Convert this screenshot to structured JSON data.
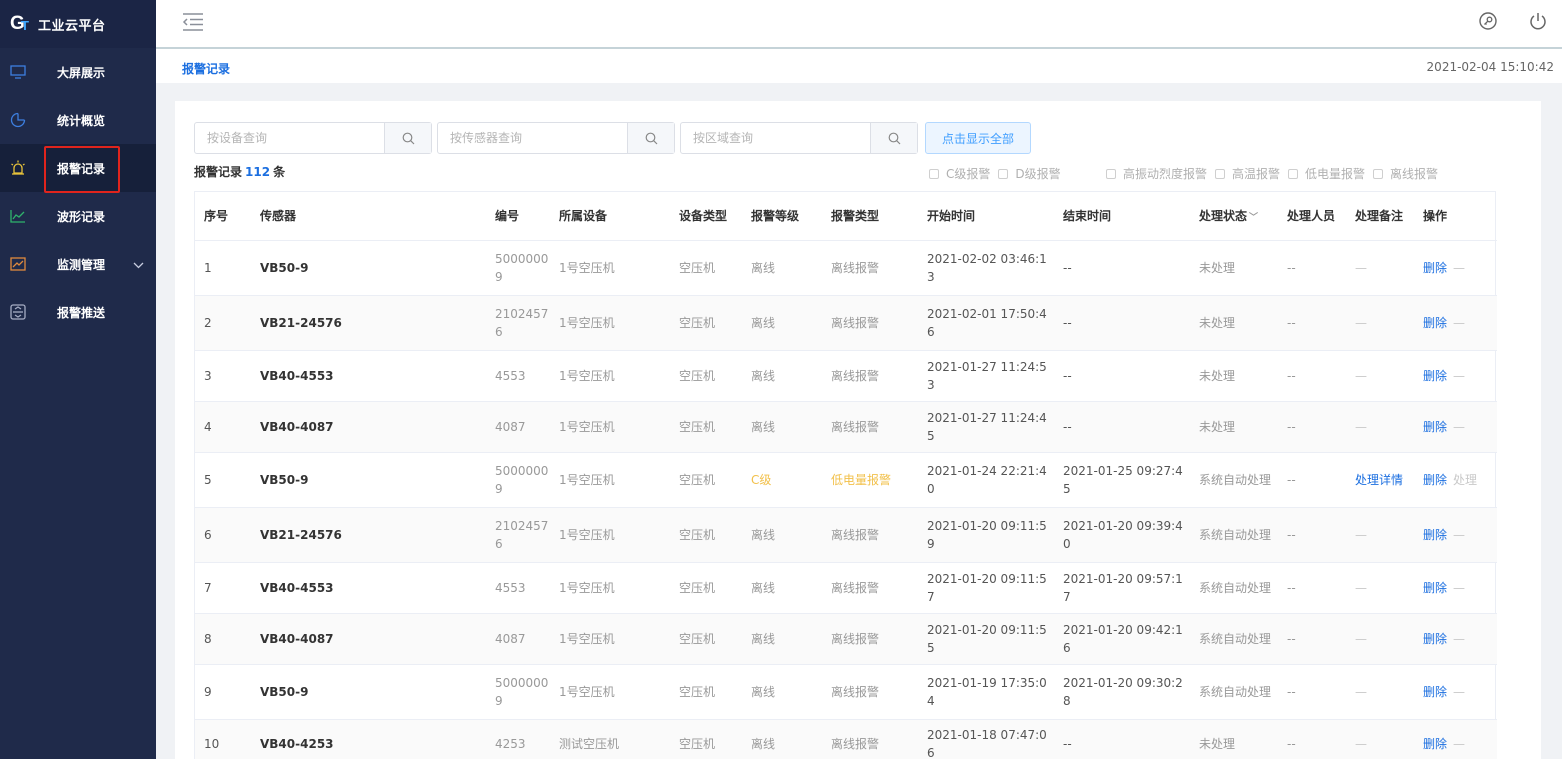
{
  "app": {
    "title": "工业云平台"
  },
  "sidebar": {
    "items": [
      {
        "label": "大屏展示",
        "icon": "monitor-icon"
      },
      {
        "label": "统计概览",
        "icon": "pie-chart-icon"
      },
      {
        "label": "报警记录",
        "icon": "alarm-icon",
        "active": true
      },
      {
        "label": "波形记录",
        "icon": "line-chart-icon"
      },
      {
        "label": "监测管理",
        "icon": "trend-icon",
        "has_submenu": true
      },
      {
        "label": "报警推送",
        "icon": "push-icon"
      }
    ]
  },
  "breadcrumb": "报警记录",
  "clock": "2021-02-04 15:10:42",
  "search": {
    "device_placeholder": "按设备查询",
    "sensor_placeholder": "按传感器查询",
    "region_placeholder": "按区域查询",
    "show_all": "点击显示全部"
  },
  "count": {
    "prefix": "报警记录",
    "value": "112",
    "suffix": "条"
  },
  "filters": {
    "level": [
      "C级报警",
      "D级报警"
    ],
    "type": [
      "高振动烈度报警",
      "高温报警",
      "低电量报警",
      "离线报警"
    ]
  },
  "table": {
    "headers": [
      "序号",
      "传感器",
      "编号",
      "所属设备",
      "设备类型",
      "报警等级",
      "报警类型",
      "开始时间",
      "结束时间",
      "处理状态",
      "处理人员",
      "处理备注",
      "操作"
    ],
    "rows": [
      {
        "no": "1",
        "sensor": "VB50-9",
        "code": "50000009",
        "device": "1号空压机",
        "dtype": "空压机",
        "level": "离线",
        "atype": "离线报警",
        "start": "2021-02-02 03:46:13",
        "end": "--",
        "status": "未处理",
        "person": "--",
        "note": "—",
        "op": "删除",
        "op2": "—"
      },
      {
        "no": "2",
        "sensor": "VB21-24576",
        "code": "21024576",
        "device": "1号空压机",
        "dtype": "空压机",
        "level": "离线",
        "atype": "离线报警",
        "start": "2021-02-01 17:50:46",
        "end": "--",
        "status": "未处理",
        "person": "--",
        "note": "—",
        "op": "删除",
        "op2": "—"
      },
      {
        "no": "3",
        "sensor": "VB40-4553",
        "code": "4553",
        "device": "1号空压机",
        "dtype": "空压机",
        "level": "离线",
        "atype": "离线报警",
        "start": "2021-01-27 11:24:53",
        "end": "--",
        "status": "未处理",
        "person": "--",
        "note": "—",
        "op": "删除",
        "op2": "—"
      },
      {
        "no": "4",
        "sensor": "VB40-4087",
        "code": "4087",
        "device": "1号空压机",
        "dtype": "空压机",
        "level": "离线",
        "atype": "离线报警",
        "start": "2021-01-27 11:24:45",
        "end": "--",
        "status": "未处理",
        "person": "--",
        "note": "—",
        "op": "删除",
        "op2": "—"
      },
      {
        "no": "5",
        "sensor": "VB50-9",
        "code": "50000009",
        "device": "1号空压机",
        "dtype": "空压机",
        "level": "C级",
        "atype": "低电量报警",
        "start": "2021-01-24 22:21:40",
        "end": "2021-01-25 09:27:45",
        "status": "系统自动处理",
        "person": "--",
        "note": "处理详情",
        "op": "删除",
        "op2": "处理"
      },
      {
        "no": "6",
        "sensor": "VB21-24576",
        "code": "21024576",
        "device": "1号空压机",
        "dtype": "空压机",
        "level": "离线",
        "atype": "离线报警",
        "start": "2021-01-20 09:11:59",
        "end": "2021-01-20 09:39:40",
        "status": "系统自动处理",
        "person": "--",
        "note": "—",
        "op": "删除",
        "op2": "—"
      },
      {
        "no": "7",
        "sensor": "VB40-4553",
        "code": "4553",
        "device": "1号空压机",
        "dtype": "空压机",
        "level": "离线",
        "atype": "离线报警",
        "start": "2021-01-20 09:11:57",
        "end": "2021-01-20 09:57:17",
        "status": "系统自动处理",
        "person": "--",
        "note": "—",
        "op": "删除",
        "op2": "—"
      },
      {
        "no": "8",
        "sensor": "VB40-4087",
        "code": "4087",
        "device": "1号空压机",
        "dtype": "空压机",
        "level": "离线",
        "atype": "离线报警",
        "start": "2021-01-20 09:11:55",
        "end": "2021-01-20 09:42:16",
        "status": "系统自动处理",
        "person": "--",
        "note": "—",
        "op": "删除",
        "op2": "—"
      },
      {
        "no": "9",
        "sensor": "VB50-9",
        "code": "50000009",
        "device": "1号空压机",
        "dtype": "空压机",
        "level": "离线",
        "atype": "离线报警",
        "start": "2021-01-19 17:35:04",
        "end": "2021-01-20 09:30:28",
        "status": "系统自动处理",
        "person": "--",
        "note": "—",
        "op": "删除",
        "op2": "—"
      },
      {
        "no": "10",
        "sensor": "VB40-4253",
        "code": "4253",
        "device": "测试空压机",
        "dtype": "空压机",
        "level": "离线",
        "atype": "离线报警",
        "start": "2021-01-18 07:47:06",
        "end": "--",
        "status": "未处理",
        "person": "--",
        "note": "—",
        "op": "删除",
        "op2": "—"
      }
    ]
  },
  "colors": {
    "sidebar_bg": "#1f2a4a",
    "accent": "#1c6fe0",
    "warning": "#f2c04a",
    "highlight": "#e0241d"
  }
}
